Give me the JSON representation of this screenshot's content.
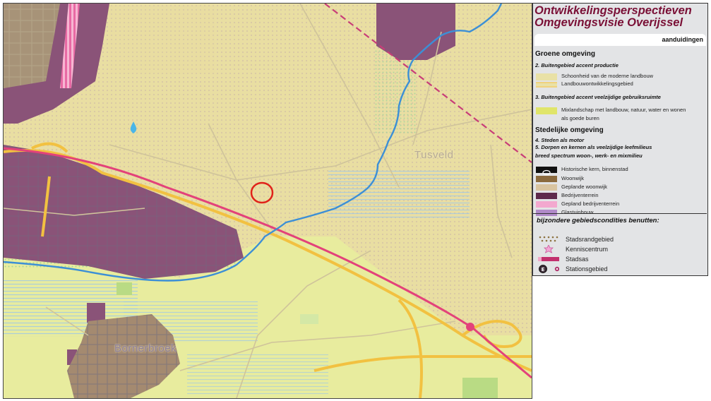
{
  "map": {
    "place_labels": [
      "Tusveld",
      "Bornerbroek"
    ],
    "colors": {
      "background": "#e9dea2",
      "mixlandschap": "#e8ec9e",
      "bedrijventerrein": "#8a5378",
      "stadsas": "#e3427a",
      "road_yellow": "#f2c141",
      "water": "#3c8fd6"
    },
    "icons": [
      "water-drop-icon",
      "highlight-circle"
    ]
  },
  "legend": {
    "title_line1": "Ontwikkelingsperspectieven",
    "title_line2": "Omgevingsvisie Overijssel",
    "tab_label": "aanduidingen",
    "groene_heading": "Groene omgeving",
    "sub_productie": "2. Buitengebied accent productie",
    "item_schoonheid": "Schoonheid van de moderne landbouw",
    "item_landbouw": "Landbouwontwikkelingsgebied",
    "sub_veelzijdig": "3. Buitengebied accent veelzijdige gebruiksruimte",
    "item_mix_line1": "Mixlandschap met landbouw, natuur, water en wonen",
    "item_mix_line2": "als goede buren",
    "stedelijke_heading": "Stedelijke omgeving",
    "sub_steden": "4. Steden als motor",
    "sub_dorpen": "5. Dorpen en kernen als veelzijdige leefmilieus",
    "sub_breed": "breed spectrum woon-, werk- en mixmilieu",
    "item_historische": "Historische kern, binnenstad",
    "item_woonwijk": "Woonwijk",
    "item_geplande_woonwijk": "Geplande woonwijk",
    "item_bedrijventerrein": "Bedrijventerrein",
    "item_gepland_bedrijventerrein": "Gepland bedrijventerrein",
    "item_glastuinbouw": "Glastuinbouw",
    "bijzondere_heading": "bijzondere gebiedscondities benutten:",
    "item_stadsrand": "Stadsrandgebied",
    "item_kennis": "Kenniscentrum",
    "item_stadsas": "Stadsas",
    "item_station": "Stationsgebied"
  }
}
